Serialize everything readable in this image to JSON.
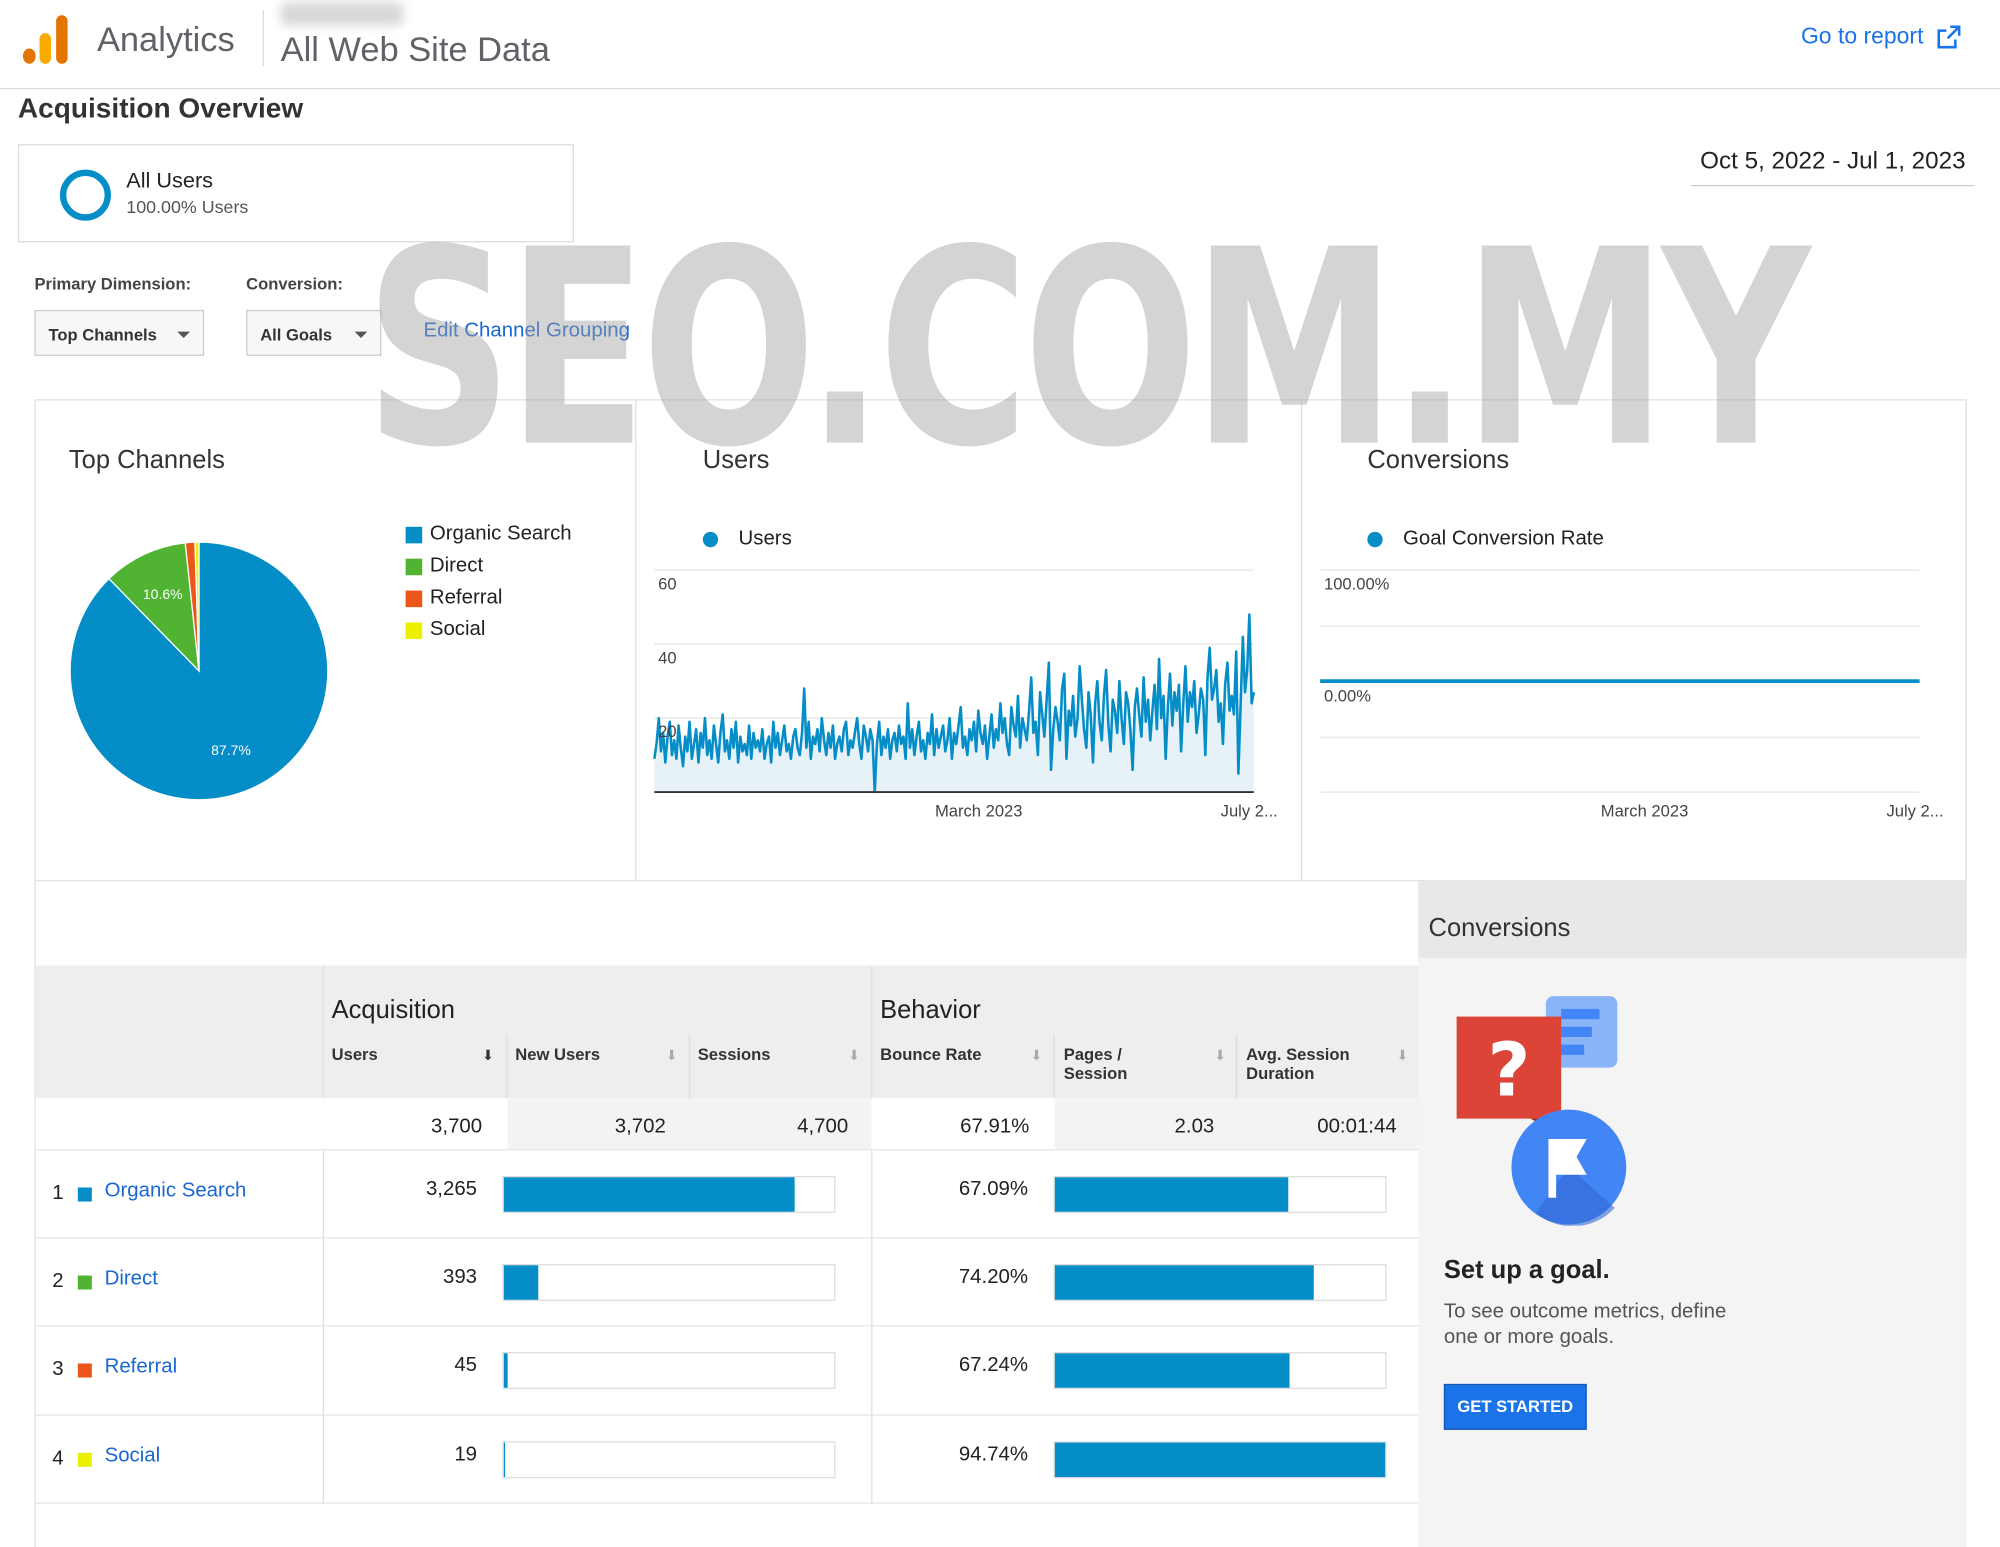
{
  "header": {
    "app_name": "Analytics",
    "view_name": "All Web Site Data",
    "goto_report": "Go to report"
  },
  "page_title": "Acquisition Overview",
  "segment": {
    "name": "All Users",
    "sub": "100.00% Users"
  },
  "date_range": "Oct 5, 2022 - Jul 1, 2023",
  "controls": {
    "primary_dimension_label": "Primary Dimension:",
    "primary_dimension_value": "Top Channels",
    "conversion_label": "Conversion:",
    "conversion_value": "All Goals",
    "edit_grouping": "Edit Channel Grouping"
  },
  "watermark": "SEO.COM.MY",
  "colors": {
    "organic": "#058dc7",
    "direct": "#50b432",
    "referral": "#ed561b",
    "social": "#edef00",
    "accent": "#1a73e8"
  },
  "panels": {
    "top_channels": {
      "title": "Top Channels",
      "legend": [
        "Organic Search",
        "Direct",
        "Referral",
        "Social"
      ]
    },
    "users": {
      "title": "Users",
      "legend": "Users",
      "x_ticks": [
        "March 2023",
        "July 2..."
      ],
      "y_ticks": [
        "60",
        "40",
        "20"
      ]
    },
    "conversions": {
      "title": "Conversions",
      "legend": "Goal Conversion Rate",
      "x_ticks": [
        "March 2023",
        "July 2..."
      ],
      "y_ticks": [
        "100.00%",
        "0.00%"
      ]
    }
  },
  "chart_data": [
    {
      "type": "pie",
      "title": "Top Channels",
      "categories": [
        "Organic Search",
        "Direct",
        "Referral",
        "Social"
      ],
      "values": [
        87.7,
        10.6,
        1.2,
        0.5
      ],
      "slice_labels": [
        "87.7%",
        "10.6%",
        "",
        ""
      ],
      "colors": [
        "#058dc7",
        "#50b432",
        "#ed561b",
        "#edef00"
      ]
    },
    {
      "type": "area",
      "title": "Users",
      "series": [
        {
          "name": "Users",
          "values": [
            9,
            13,
            20,
            11,
            16,
            8,
            15,
            19,
            10,
            14,
            9,
            18,
            12,
            7,
            15,
            11,
            19,
            9,
            13,
            17,
            8,
            16,
            12,
            20,
            10,
            14,
            9,
            18,
            13,
            8,
            16,
            21,
            11,
            14,
            9,
            17,
            12,
            19,
            8,
            15,
            11,
            13,
            10,
            18,
            9,
            16,
            12,
            14,
            11,
            17,
            9,
            13,
            15,
            8,
            19,
            12,
            16,
            10,
            14,
            18,
            11,
            13,
            9,
            15,
            17,
            12,
            10,
            16,
            28,
            12,
            19,
            9,
            15,
            13,
            17,
            11,
            20,
            14,
            10,
            16,
            12,
            18,
            9,
            13,
            15,
            11,
            17,
            19,
            10,
            14,
            12,
            16,
            20,
            13,
            9,
            18,
            15,
            11,
            17,
            14,
            0,
            13,
            19,
            10,
            15,
            12,
            17,
            9,
            14,
            16,
            11,
            18,
            13,
            15,
            9,
            24,
            12,
            17,
            10,
            15,
            19,
            11,
            14,
            9,
            16,
            13,
            21,
            10,
            17,
            12,
            15,
            18,
            11,
            14,
            20,
            9,
            16,
            13,
            18,
            23,
            12,
            15,
            10,
            17,
            14,
            19,
            11,
            22,
            16,
            13,
            18,
            9,
            15,
            21,
            12,
            17,
            14,
            24,
            16,
            20,
            13,
            10,
            23,
            18,
            15,
            26,
            12,
            20,
            17,
            14,
            22,
            31,
            16,
            19,
            10,
            27,
            21,
            15,
            25,
            35,
            6,
            17,
            23,
            19,
            14,
            28,
            32,
            9,
            22,
            18,
            26,
            15,
            20,
            34,
            25,
            17,
            12,
            27,
            21,
            8,
            24,
            30,
            19,
            14,
            26,
            33,
            18,
            11,
            25,
            22,
            16,
            30,
            20,
            13,
            27,
            24,
            17,
            6,
            23,
            28,
            21,
            15,
            31,
            19,
            25,
            14,
            22,
            29,
            17,
            36,
            20,
            26,
            9,
            23,
            32,
            18,
            27,
            22,
            29,
            11,
            24,
            34,
            19,
            27,
            23,
            30,
            16,
            21,
            28,
            25,
            10,
            31,
            39,
            25,
            28,
            33,
            19,
            24,
            13,
            29,
            35,
            22,
            26,
            21,
            38,
            5,
            23,
            42,
            27,
            33,
            48,
            24,
            27
          ]
        }
      ],
      "x_ticks": [
        "March 2023",
        "July 2..."
      ],
      "ylim": [
        0,
        60
      ]
    },
    {
      "type": "line",
      "title": "Conversions",
      "series": [
        {
          "name": "Goal Conversion Rate",
          "values": [
            0,
            0
          ]
        }
      ],
      "x_ticks": [
        "March 2023",
        "July 2..."
      ],
      "y_ticks": [
        "100.00%",
        "0.00%"
      ]
    }
  ],
  "table": {
    "groups": {
      "acquisition": "Acquisition",
      "behavior": "Behavior"
    },
    "columns": [
      "Users",
      "New Users",
      "Sessions",
      "Bounce Rate",
      "Pages /",
      "Session",
      "Avg. Session",
      "Duration"
    ],
    "totals": {
      "users": "3,700",
      "new_users": "3,702",
      "sessions": "4,700",
      "bounce_rate": "67.91%",
      "pages_session": "2.03",
      "avg_duration": "00:01:44"
    },
    "rows": [
      {
        "rank": "1",
        "name": "Organic Search",
        "users": "3,265",
        "users_share": 0.882,
        "bounce": "67.09%",
        "bounce_share": 0.708
      },
      {
        "rank": "2",
        "name": "Direct",
        "users": "393",
        "users_share": 0.106,
        "bounce": "74.20%",
        "bounce_share": 0.783
      },
      {
        "rank": "3",
        "name": "Referral",
        "users": "45",
        "users_share": 0.012,
        "bounce": "67.24%",
        "bounce_share": 0.71
      },
      {
        "rank": "4",
        "name": "Social",
        "users": "19",
        "users_share": 0.005,
        "bounce": "94.74%",
        "bounce_share": 1.0
      }
    ]
  },
  "conversions_panel": {
    "title": "Conversions",
    "heading": "Set up a goal.",
    "body_line1": "To see outcome metrics, define",
    "body_line2": "one or more goals.",
    "button": "GET STARTED"
  }
}
